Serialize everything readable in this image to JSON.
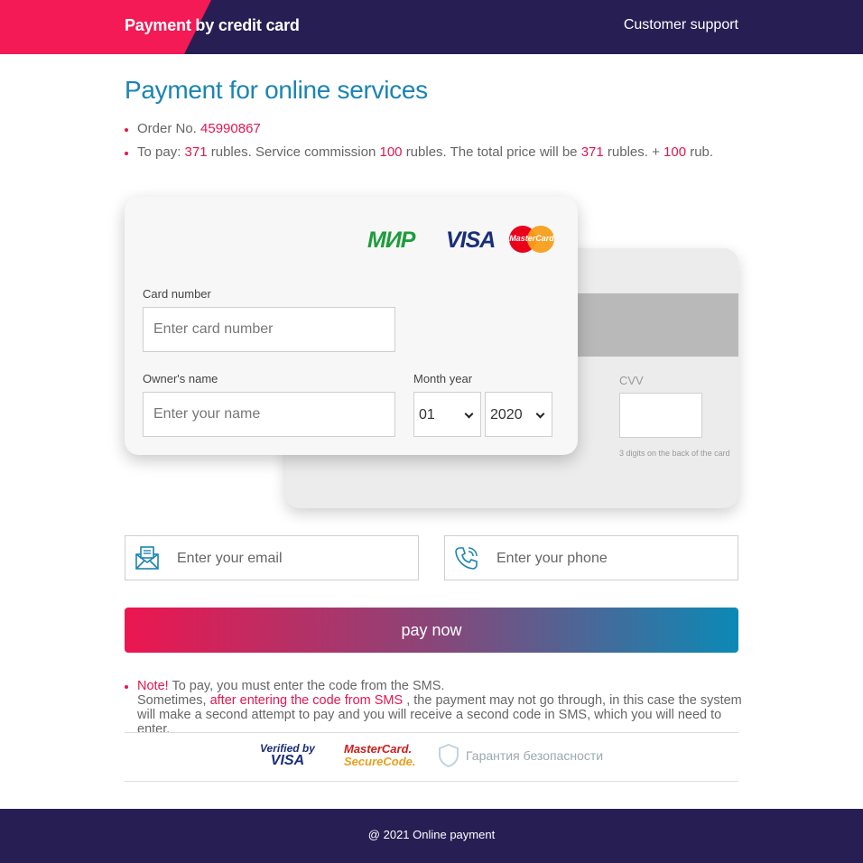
{
  "header": {
    "title": "Payment by credit card",
    "support_label": "Customer support"
  },
  "page": {
    "title": "Payment for online services"
  },
  "order": {
    "label": "Order No.",
    "number": "45990867",
    "pay_prefix": "To pay:",
    "amount": "371",
    "rubles_commission": "rubles. Service commission",
    "commission": "100",
    "rubles_total": "rubles. The total price will be",
    "total": "371",
    "rubles_plus": "rubles. +",
    "extra": "100",
    "rub": "rub."
  },
  "card_brands": {
    "mir": "МИР",
    "visa": "VISA",
    "mastercard": "MasterCard"
  },
  "front_card": {
    "card_number_label": "Card number",
    "card_number_placeholder": "Enter card number",
    "owner_label": "Owner's name",
    "owner_placeholder": "Enter your name",
    "month_year_label": "Month year",
    "month_value": "01",
    "year_value": "2020"
  },
  "back_card": {
    "cvv_label": "CVV",
    "cvv_hint": "3 digits on the back of the card"
  },
  "contacts": {
    "email_placeholder": "Enter your email",
    "phone_placeholder": "Enter your phone"
  },
  "pay_button": {
    "label": "pay now"
  },
  "note": {
    "title": "Note!",
    "line1": "To pay, you must enter the code from the SMS.",
    "line2_start": "Sometimes,",
    "line2_highlight": "after entering the code from SMS",
    "line2_end": ", the payment may not go through, in this case the system will make a second attempt to pay and you will receive a second code in SMS, which you will need to enter."
  },
  "security": {
    "verified_by": "Verified by",
    "verified_visa": "VISA",
    "mc_top": "MasterCard.",
    "mc_bottom": "SecureCode.",
    "guarantee": "Гарантия безопасности"
  },
  "footer": {
    "text": "@ 2021 Online payment"
  },
  "colors": {
    "header_bg": "#271f53",
    "accent_red": "#e4174e",
    "title_blue": "#1b84b3"
  }
}
